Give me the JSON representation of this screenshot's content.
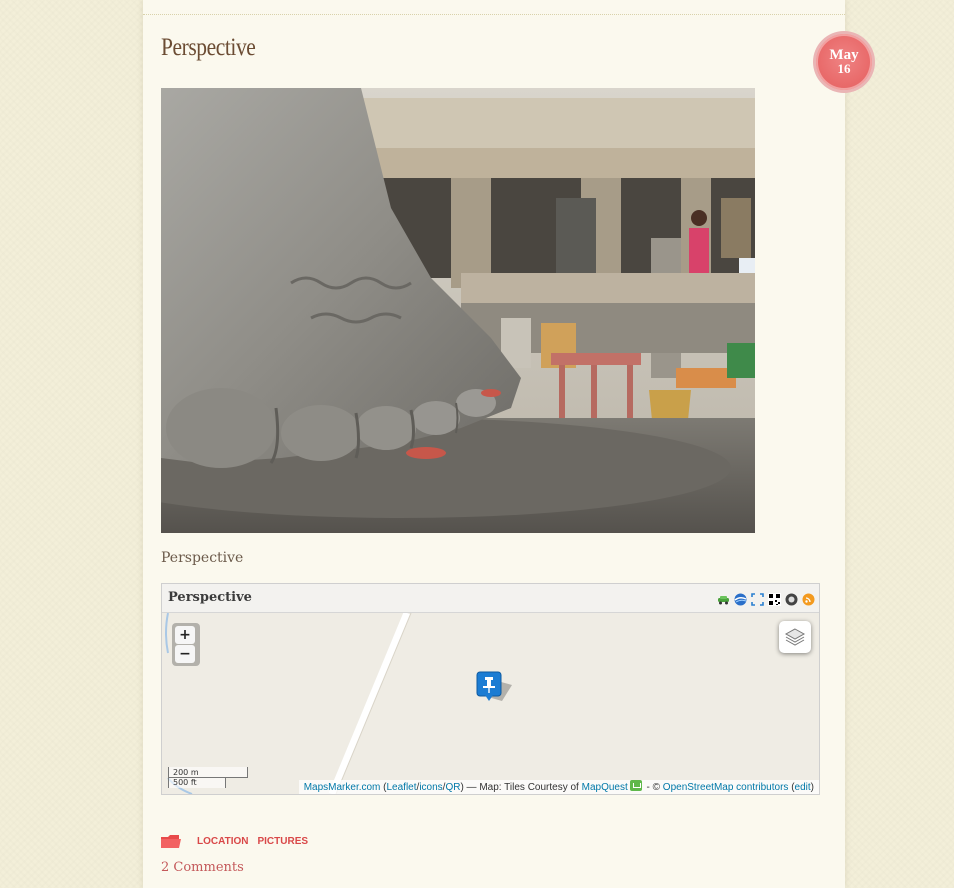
{
  "post": {
    "title": "Perspective",
    "date": {
      "month": "May",
      "day": "16"
    },
    "photo_caption": "Perspective"
  },
  "map": {
    "title": "Perspective",
    "tool_icons": [
      "car-icon",
      "google-earth-icon",
      "fullscreen-icon",
      "qr-code-icon",
      "geo-rss-icon",
      "rss-icon"
    ],
    "zoom_in": "+",
    "zoom_out": "−",
    "layers_icon": "layers-icon",
    "marker_icon": "map-pin-icon",
    "scale": {
      "metric": "200 m",
      "imperial": "500 ft"
    },
    "attribution": {
      "mapsmarker": "MapsMarker.com",
      "open_paren": " (",
      "leaflet": "Leaflet",
      "slash1": "/",
      "icons": "icons",
      "slash2": "/",
      "qr": "QR",
      "after_qr": ") — Map: Tiles Courtesy of ",
      "mapquest": "MapQuest",
      "after_mq": " - © ",
      "osm": "OpenStreetMap contributors",
      "edit_open": " (",
      "edit": "edit",
      "edit_close": ")"
    }
  },
  "footer": {
    "category_icon": "folder-icon",
    "categories": [
      "LOCATION",
      "PICTURES"
    ],
    "comments": "2 Comments"
  },
  "colors": {
    "title": "#6b4c33",
    "badge": "#e96b6b",
    "link": "#0078a8",
    "tag": "#d94848"
  }
}
